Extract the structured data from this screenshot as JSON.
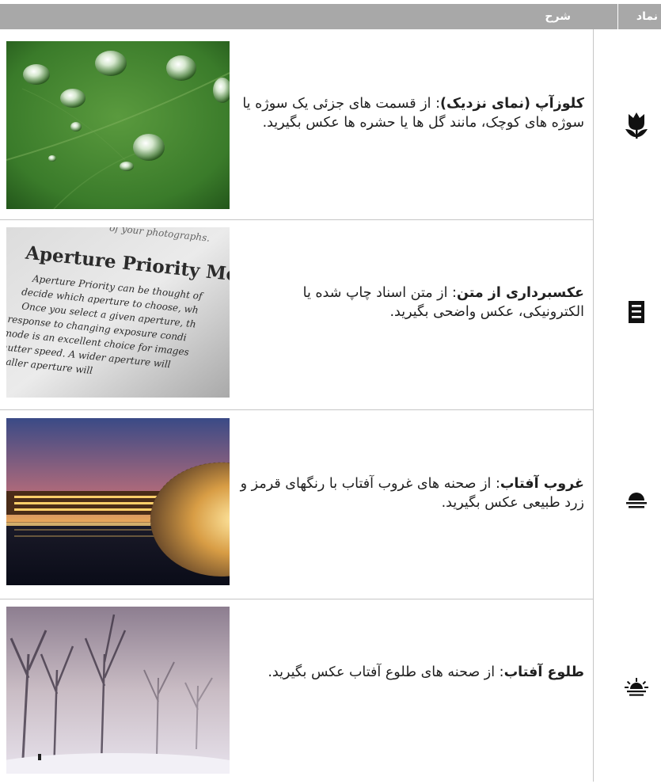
{
  "header": {
    "symbol_label": "نماد",
    "description_label": "شرح"
  },
  "rows": [
    {
      "term": "کلوزآپ (نمای نزدیک)",
      "text": ": از قسمت های جزئی یک سوژه یا سوژه های کوچک، مانند گل ها یا حشره ها عکس بگیرید.",
      "icon": "tulip-macro-icon",
      "image": "water-drops-on-leaf-photo"
    },
    {
      "term": "عکسبرداری از متن",
      "text": ": از متن اسناد چاپ شده یا الکترونیکی، عکس واضحی بگیرید.",
      "icon": "document-text-icon",
      "image": "printed-text-page-photo",
      "photo_text": {
        "line0": "of your photographs.",
        "title": "Aperture Priority Mode",
        "lines": [
          "Aperture Priority can be thought of",
          "decide which aperture to choose, wh",
          "Once you select a given aperture, th",
          "response to changing exposure condi",
          "mode is an excellent choice for images",
          "shutter speed. A wider aperture will",
          "smaller aperture will"
        ]
      }
    },
    {
      "term": "غروب آفتاب",
      "text": ": از صحنه های غروب آفتاب با رنگهای قرمز و زرد طبیعی عکس بگیرید.",
      "icon": "sunset-icon",
      "image": "sunset-building-photo"
    },
    {
      "term": "طلوع آفتاب",
      "text": ": از صحنه های طلوع آفتاب عکس بگیرید.",
      "icon": "sunrise-icon",
      "image": "misty-sunrise-trees-photo"
    }
  ],
  "colors": {
    "header_bg": "#a8a8a8",
    "rule": "#c6c6c6"
  }
}
